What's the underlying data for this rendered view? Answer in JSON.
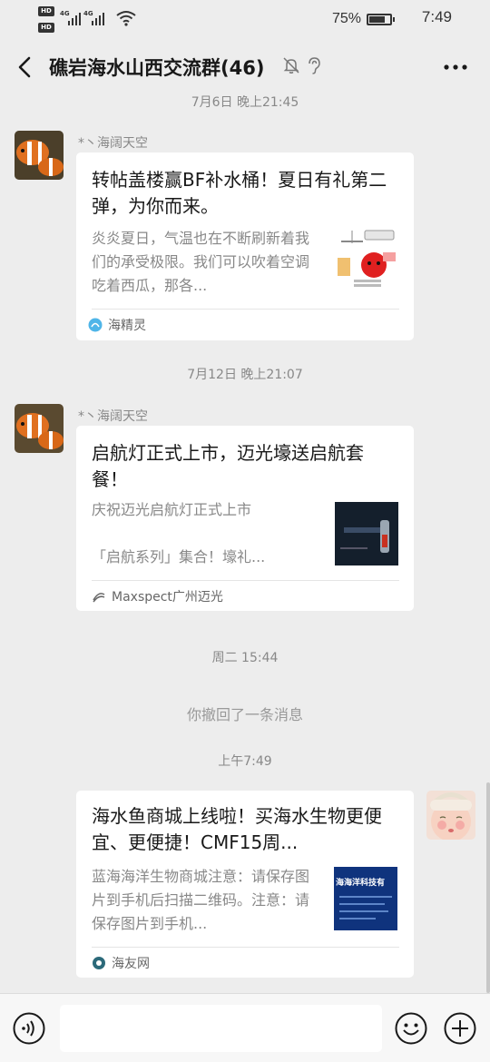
{
  "status_bar": {
    "hd1": "HD",
    "hd2": "HD",
    "net1": "4G",
    "net2": "4G",
    "battery_pct": "75%",
    "battery_level": 0.75,
    "time": "7:49"
  },
  "header": {
    "title": "礁岩海水山西交流群(46)",
    "icons": [
      "back-icon",
      "mute-bell-icon",
      "earpiece-icon",
      "more-icon"
    ]
  },
  "messages": [
    {
      "type": "timestamp",
      "text": "7月6日 晚上21:45"
    },
    {
      "type": "link_card",
      "sender": "*丶海阔天空",
      "title": "转帖盖楼赢BF补水桶！夏日有礼第二弹，为你而来。",
      "desc": "炎炎夏日，气温也在不断刷新着我们的承受极限。我们可以吹着空调吃着西瓜，那各...",
      "source": "海精灵"
    },
    {
      "type": "timestamp",
      "text": "7月12日 晚上21:07"
    },
    {
      "type": "link_card",
      "sender": "*丶海阔天空",
      "title": "启航灯正式上市，迈光壕送启航套餐！",
      "desc": "庆祝迈光启航灯正式上市\n\n「启航系列」集合！壕礼...",
      "source": "Maxspect广州迈光"
    },
    {
      "type": "timestamp",
      "text": "周二 15:44"
    },
    {
      "type": "system",
      "text": "你撤回了一条消息"
    },
    {
      "type": "timestamp",
      "text": "上午7:49"
    },
    {
      "type": "link_card",
      "sender": "",
      "title": "海水鱼商城上线啦！买海水生物更便宜、更便捷！CMF15周...",
      "desc": "蓝海海洋生物商城注意：请保存图片到手机后扫描二维码。注意：请保存图片到手机...",
      "source": "海友网",
      "thumb_text": "海海洋科技有"
    }
  ],
  "input_bar": {
    "placeholder": "",
    "icons": [
      "voice-icon",
      "emoji-icon",
      "plus-icon"
    ]
  },
  "colors": {
    "background": "#ededed",
    "card": "#ffffff",
    "muted_text": "#888888",
    "text": "#191919"
  }
}
